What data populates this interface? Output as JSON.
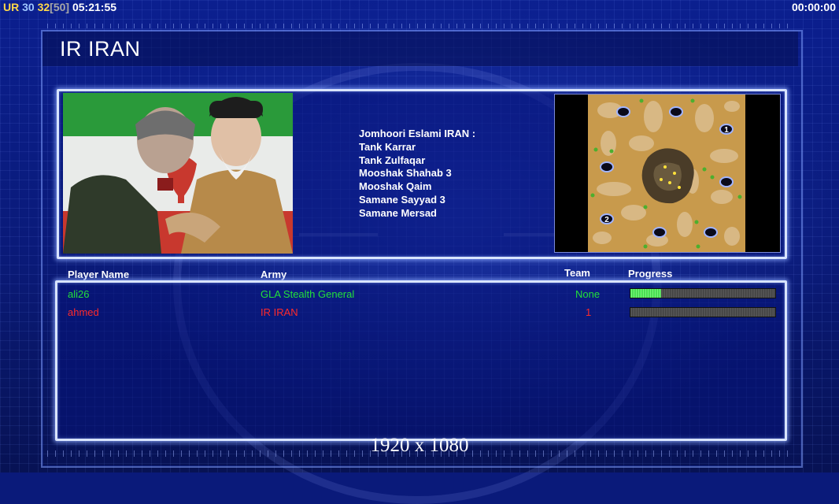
{
  "hud": {
    "ur": "UR",
    "val_a": "30",
    "val_b": "32",
    "val_c": "[50]",
    "clock": "05:21:55",
    "timer": "00:00:00"
  },
  "title": "IR IRAN",
  "units": {
    "heading": "Jomhoori Eslami IRAN :",
    "items": [
      "Tank Karrar",
      "Tank Zulfaqar",
      "Mooshak Shahab 3",
      "Mooshak Qaim",
      "Samane Sayyad 3",
      "Samane Mersad"
    ]
  },
  "minimap": {
    "start_labels": [
      "1",
      "2"
    ]
  },
  "table": {
    "headers": {
      "player": "Player Name",
      "army": "Army",
      "team": "Team",
      "progress": "Progress"
    },
    "rows": [
      {
        "player": "ali26",
        "army": "GLA Stealth General",
        "team": "None",
        "progress": 0.21,
        "color": "#22e03a"
      },
      {
        "player": "ahmed",
        "army": "IR IRAN",
        "team": "1",
        "progress": 0.0,
        "color": "#ff2a2a"
      }
    ]
  },
  "resolution": "1920 x 1080",
  "colors": {
    "background": "#0a1a7a",
    "panel_border": "#d8e4ff",
    "player1": "#22e03a",
    "player2": "#ff2a2a",
    "progress_fill": "#2fe03e"
  }
}
